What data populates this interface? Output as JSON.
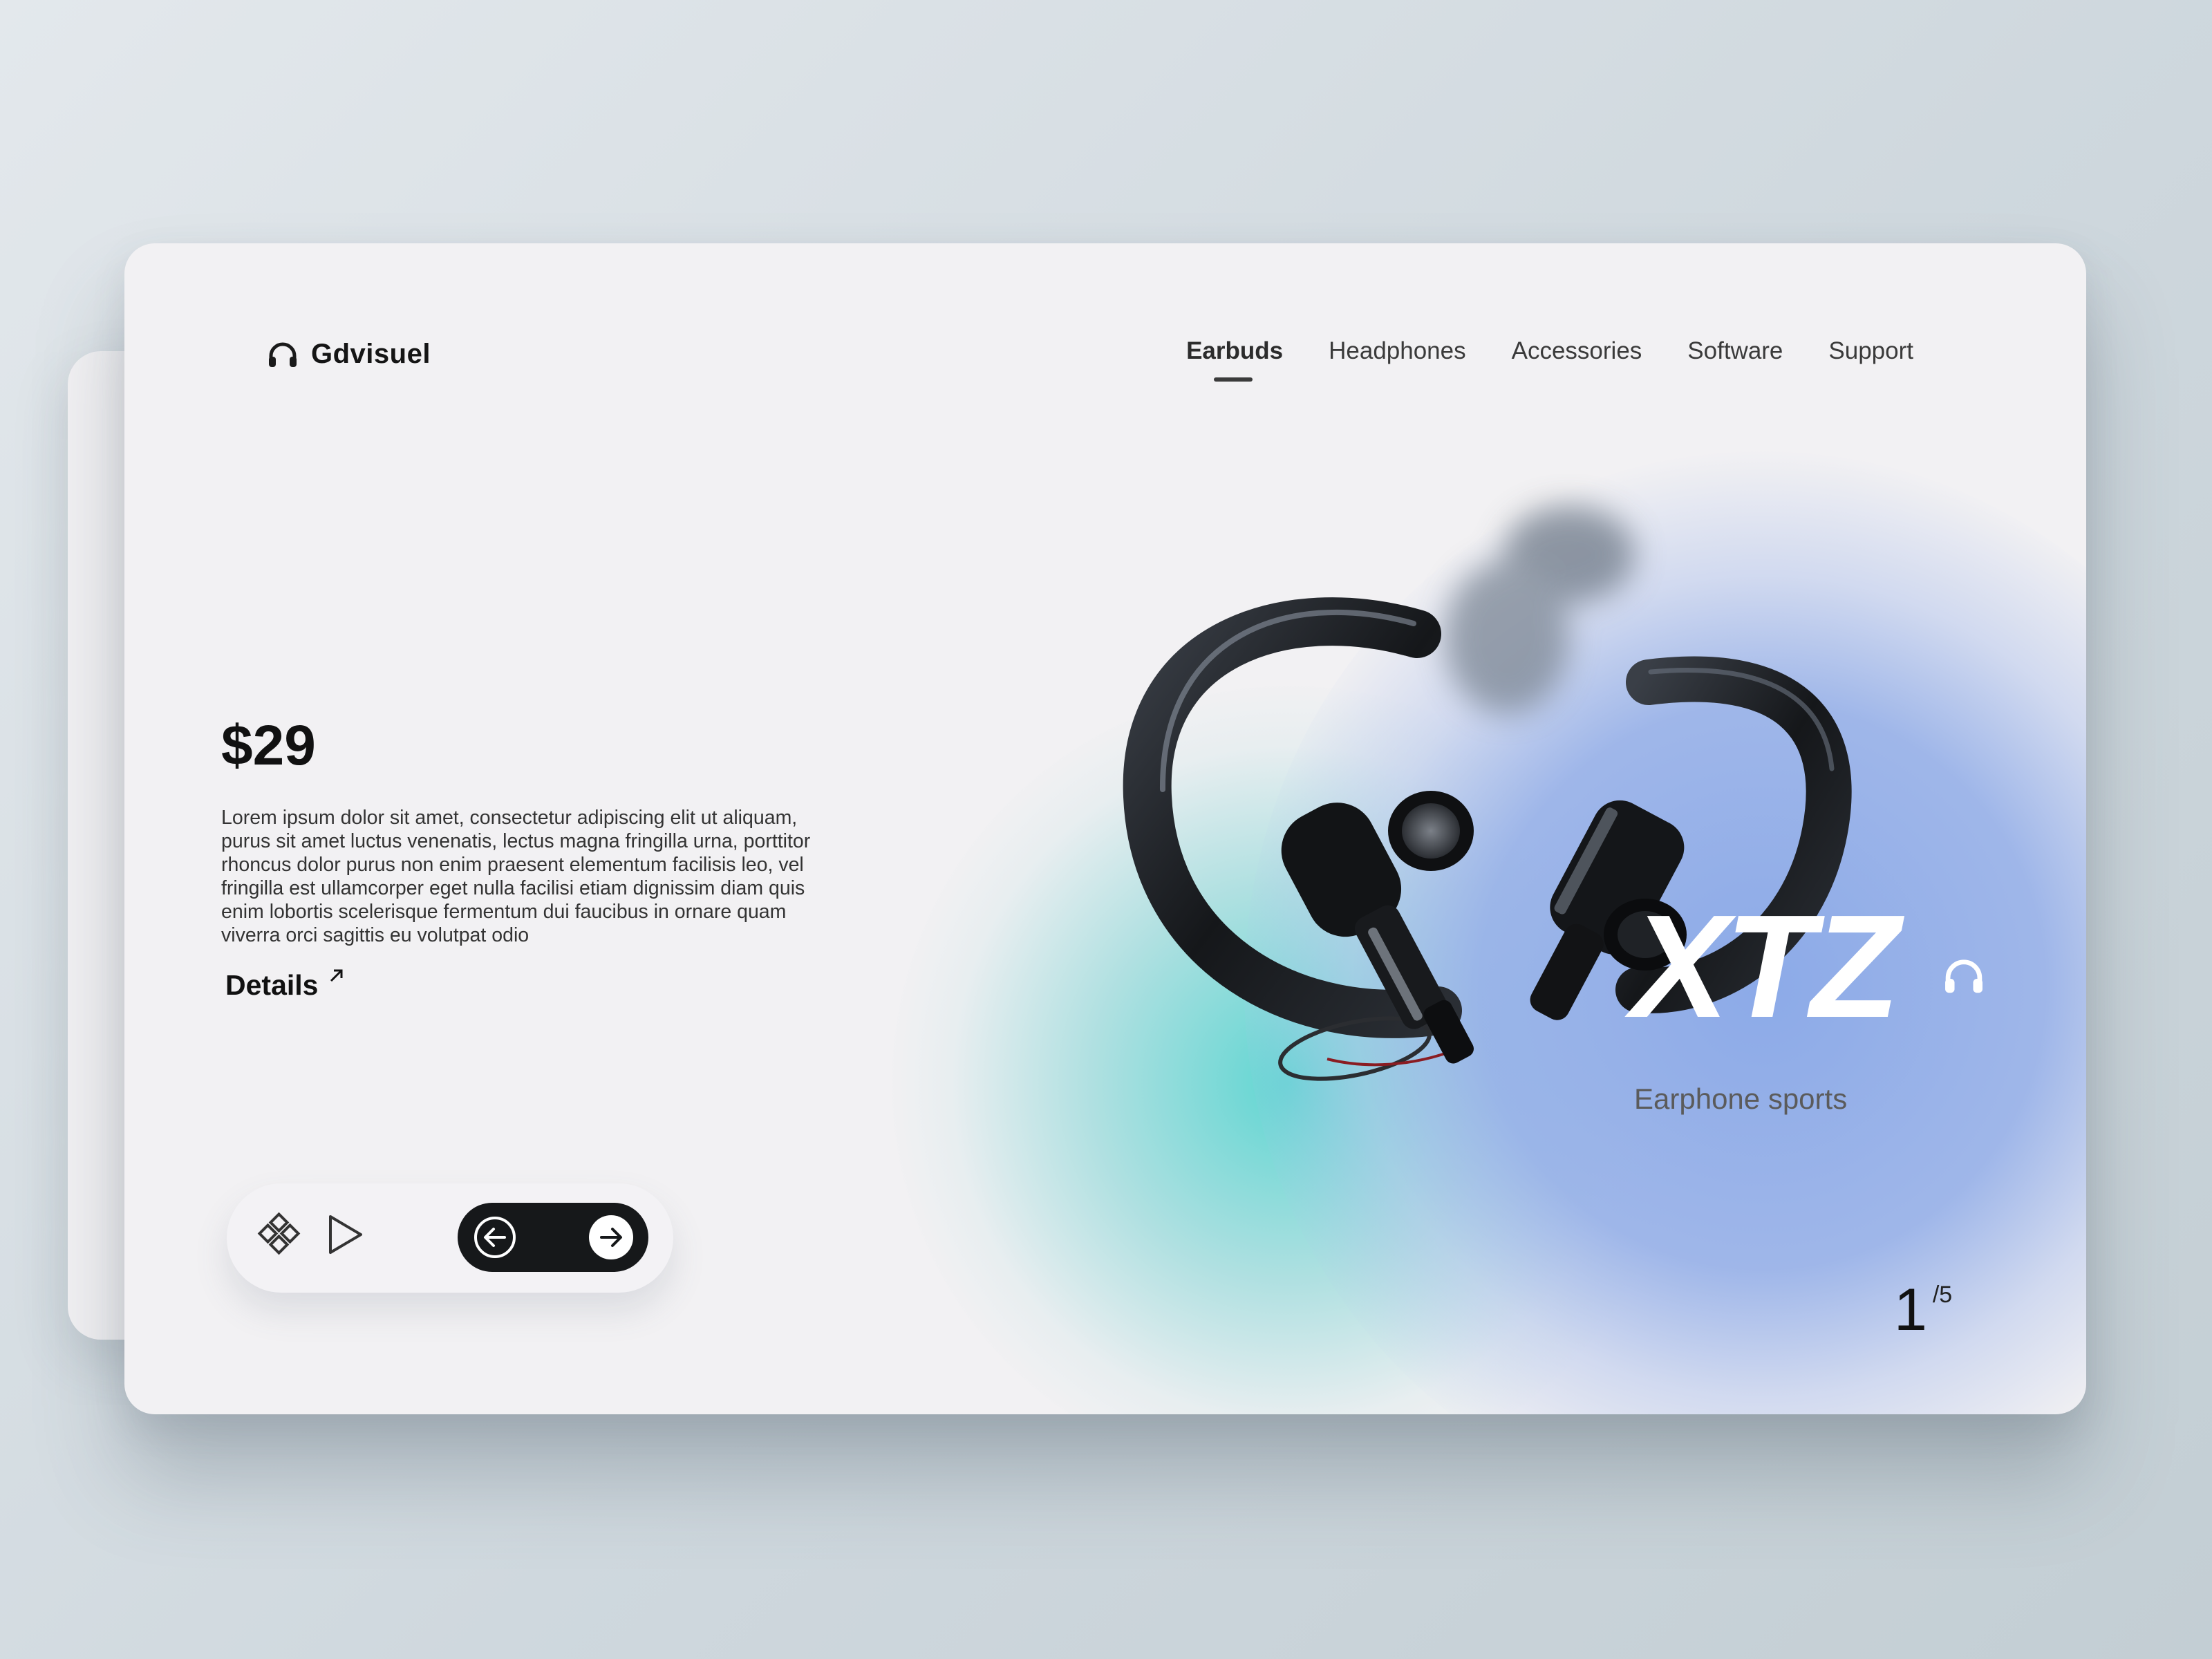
{
  "brand": {
    "name": "Gdvisuel",
    "icon": "headphones-icon"
  },
  "nav": {
    "items": [
      {
        "label": "Earbuds",
        "active": true
      },
      {
        "label": "Headphones",
        "active": false
      },
      {
        "label": "Accessories",
        "active": false
      },
      {
        "label": "Software",
        "active": false
      },
      {
        "label": "Support",
        "active": false
      }
    ]
  },
  "product": {
    "price": "$29",
    "description": "Lorem ipsum dolor sit amet, consectetur adipiscing elit ut aliquam,\n purus sit amet luctus venenatis, lectus magna fringilla urna, porttitor\nrhoncus dolor purus non enim praesent elementum facilisis leo, vel\nfringilla est ullamcorper eget nulla facilisi etiam dignissim diam quis\n enim lobortis scelerisque fermentum dui faucibus in ornare quam\nviverra orci sagittis eu volutpat odio",
    "details_label": "Details",
    "name": "XTZ",
    "subtitle": "Earphone sports"
  },
  "controls": {
    "icons": [
      "diamond-grid-icon",
      "play-icon",
      "arrow-left-circle-icon",
      "arrow-right-circle-icon"
    ]
  },
  "pagination": {
    "current": "1",
    "total": "/5"
  },
  "colors": {
    "accent_teal": "#58d4d0",
    "accent_blue": "#8caae8",
    "dark": "#16181a",
    "card_background": "#f2f1f3"
  }
}
